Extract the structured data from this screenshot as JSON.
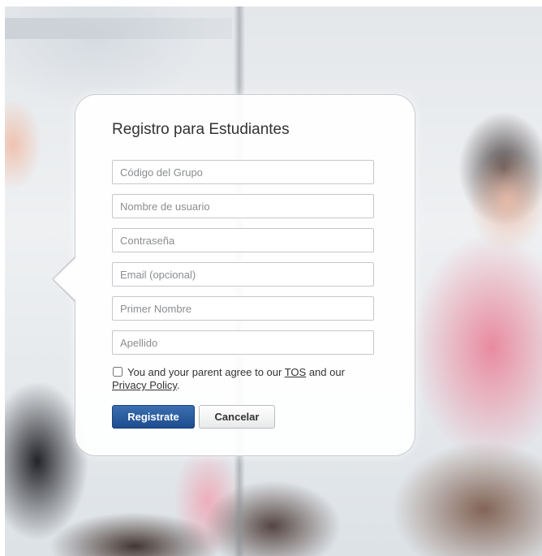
{
  "form": {
    "title": "Registro para Estudiantes",
    "fields": [
      {
        "name": "group-code",
        "placeholder": "Código del Grupo",
        "value": ""
      },
      {
        "name": "username",
        "placeholder": "Nombre de usuario",
        "value": ""
      },
      {
        "name": "password",
        "placeholder": "Contraseña",
        "value": ""
      },
      {
        "name": "email",
        "placeholder": "Email (opcional)",
        "value": ""
      },
      {
        "name": "first-name",
        "placeholder": "Primer Nombre",
        "value": ""
      },
      {
        "name": "last-name",
        "placeholder": "Apellido",
        "value": ""
      }
    ],
    "agreement": {
      "checked": false,
      "text_before": "You and your parent agree to our ",
      "tos_link": "TOS",
      "text_middle": " and our ",
      "privacy_link": "Privacy Policy",
      "text_after": "."
    },
    "buttons": {
      "register": "Registrate",
      "cancel": "Cancelar"
    }
  },
  "colors": {
    "primary_button": "#1d4d8f",
    "card_background": "#ffffff",
    "card_border": "#c9ccd0"
  }
}
